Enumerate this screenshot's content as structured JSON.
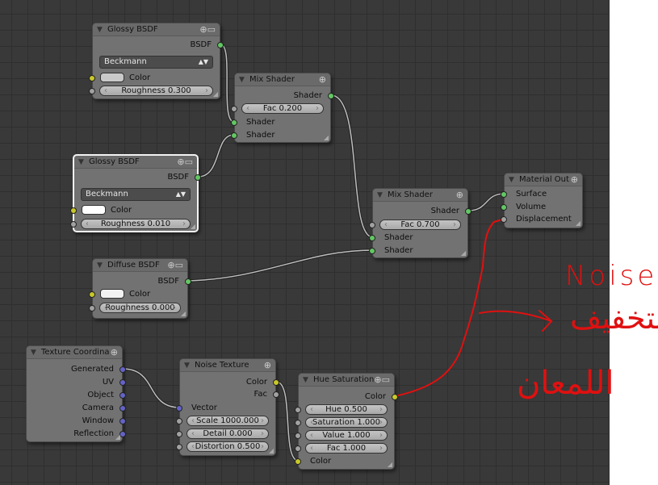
{
  "colors": {
    "socket_shader": "#63c763",
    "socket_color": "#c8c82a",
    "socket_value": "#a1a1a1",
    "socket_vector": "#6363c7",
    "annotation": "#e01010"
  },
  "glossy1": {
    "title": "Glossy BSDF",
    "out": "BSDF",
    "dist": "Beckmann",
    "color": "Color",
    "rough": "Roughness 0.300"
  },
  "mix1": {
    "title": "Mix Shader",
    "out": "Shader",
    "fac": "Fac 0.200",
    "in1": "Shader",
    "in2": "Shader"
  },
  "glossy2": {
    "title": "Glossy BSDF",
    "out": "BSDF",
    "dist": "Beckmann",
    "color": "Color",
    "rough": "Roughness 0.010"
  },
  "mix2": {
    "title": "Mix Shader",
    "out": "Shader",
    "fac": "Fac 0.700",
    "in1": "Shader",
    "in2": "Shader"
  },
  "matout": {
    "title": "Material Out",
    "surface": "Surface",
    "volume": "Volume",
    "disp": "Displacement"
  },
  "diffuse": {
    "title": "Diffuse BSDF",
    "out": "BSDF",
    "color": "Color",
    "rough": "Roughness 0.000"
  },
  "texcoord": {
    "title": "Texture Coordina",
    "outs": [
      "Generated",
      "UV",
      "Object",
      "Camera",
      "Window",
      "Reflection"
    ]
  },
  "noise": {
    "title": "Noise Texture",
    "color": "Color",
    "fac": "Fac",
    "vector": "Vector",
    "scale": "Scale 1000.000",
    "detail": "Detail 0.000",
    "distortion": "Distortion 0.500"
  },
  "huesat": {
    "title": "Hue Saturation",
    "out": "Color",
    "hue": "Hue 0.500",
    "sat": "Saturation 1.000",
    "value": "Value 1.000",
    "fac": "Fac 1.000",
    "in": "Color"
  },
  "annotation": {
    "line1": "Noise",
    "line2": "لتخفيف",
    "line3": "اللمعان"
  }
}
